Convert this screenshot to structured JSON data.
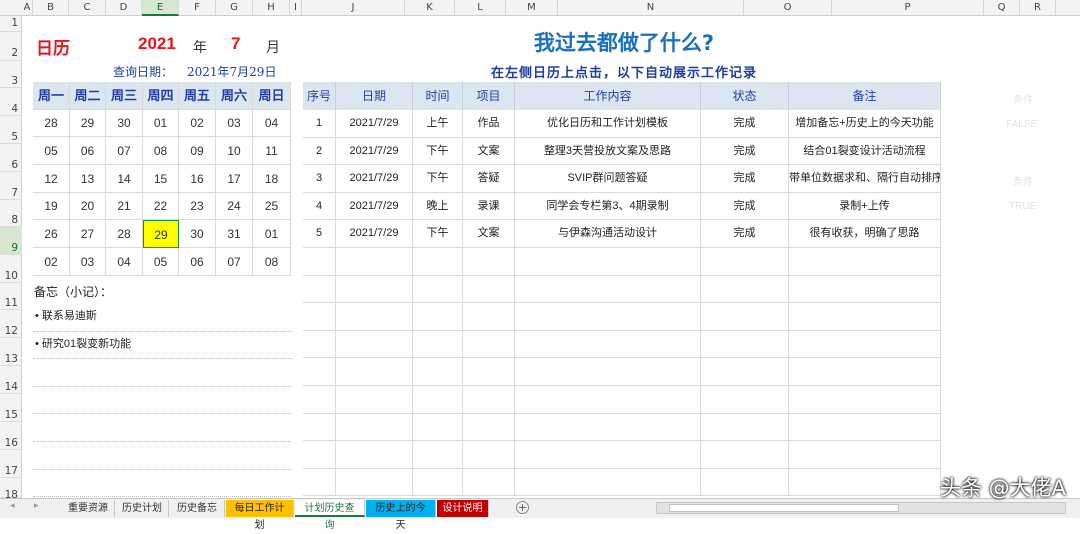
{
  "columns": [
    {
      "label": "A",
      "selected": false
    },
    {
      "label": "B",
      "selected": false
    },
    {
      "label": "C",
      "selected": false
    },
    {
      "label": "D",
      "selected": false
    },
    {
      "label": "E",
      "selected": true
    },
    {
      "label": "F",
      "selected": false
    },
    {
      "label": "G",
      "selected": false
    },
    {
      "label": "H",
      "selected": false
    },
    {
      "label": "I",
      "selected": false
    },
    {
      "label": "J",
      "selected": false
    },
    {
      "label": "K",
      "selected": false
    },
    {
      "label": "L",
      "selected": false
    },
    {
      "label": "M",
      "selected": false
    },
    {
      "label": "N",
      "selected": false
    },
    {
      "label": "O",
      "selected": false
    },
    {
      "label": "P",
      "selected": false
    },
    {
      "label": "Q",
      "selected": false
    },
    {
      "label": "R",
      "selected": false
    }
  ],
  "rows": [
    "1",
    "2",
    "3",
    "4",
    "5",
    "6",
    "7",
    "8",
    "9",
    "10",
    "11",
    "12",
    "13",
    "14",
    "15",
    "16",
    "17",
    "18"
  ],
  "selected_row": "9",
  "calendar": {
    "title": "日历",
    "year": "2021",
    "year_unit": "年",
    "month": "7",
    "month_unit": "月",
    "query_label": "查询日期：",
    "query_date": "2021年7月29日",
    "weekdays": [
      "周一",
      "周二",
      "周三",
      "周四",
      "周五",
      "周六",
      "周日"
    ],
    "weeks": [
      [
        "28",
        "29",
        "30",
        "01",
        "02",
        "03",
        "04"
      ],
      [
        "05",
        "06",
        "07",
        "08",
        "09",
        "10",
        "11"
      ],
      [
        "12",
        "13",
        "14",
        "15",
        "16",
        "17",
        "18"
      ],
      [
        "19",
        "20",
        "21",
        "22",
        "23",
        "24",
        "25"
      ],
      [
        "26",
        "27",
        "28",
        "29",
        "30",
        "31",
        "01"
      ],
      [
        "02",
        "03",
        "04",
        "05",
        "06",
        "07",
        "08"
      ]
    ],
    "selected_day": "29",
    "highlight_color": "#ffff00",
    "accent_red": "#e8141c"
  },
  "memo": {
    "title": "备忘（小记）：",
    "items": [
      "• 联系易迪斯",
      "• 研究01裂变新功能"
    ]
  },
  "main": {
    "title": "我过去都做了什么?",
    "subtitle": "在左侧日历上点击，以下自动展示工作记录",
    "title_color": "#1a6fc4",
    "headers": [
      "序号",
      "日期",
      "时间",
      "项目",
      "工作内容",
      "状态",
      "备注"
    ],
    "records": [
      [
        "1",
        "2021/7/29",
        "上午",
        "作品",
        "优化日历和工作计划模板",
        "完成",
        "增加备忘+历史上的今天功能"
      ],
      [
        "2",
        "2021/7/29",
        "下午",
        "文案",
        "整理3天营投放文案及思路",
        "完成",
        "结合01裂变设计活动流程"
      ],
      [
        "3",
        "2021/7/29",
        "下午",
        "答疑",
        "SVIP群问题答疑",
        "完成",
        "带单位数据求和、隔行自动排序"
      ],
      [
        "4",
        "2021/7/29",
        "晚上",
        "录课",
        "同学会专栏第3、4期录制",
        "完成",
        "录制+上传"
      ],
      [
        "5",
        "2021/7/29",
        "下午",
        "文案",
        "与伊森沟通活动设计",
        "完成",
        "很有收获，明确了思路"
      ]
    ]
  },
  "hidden_cells": {
    "cond1_label": "条件",
    "cond1_value": "FALSE",
    "cond2_label": "条件",
    "cond2_value": "TRUE"
  },
  "sheet_tabs": [
    {
      "label": "重要资源",
      "color": "#f0f0f0",
      "text": "#333333"
    },
    {
      "label": "历史计划",
      "color": "#f0f0f0",
      "text": "#333333"
    },
    {
      "label": "历史备忘",
      "color": "#f0f0f0",
      "text": "#333333"
    },
    {
      "label": "每日工作计划",
      "color": "#ffc000",
      "text": "#222222"
    },
    {
      "label": "计划历史查询",
      "color": "#ffffff",
      "text": "#217346"
    },
    {
      "label": "历史上的今天",
      "color": "#00b0f0",
      "text": "#222222"
    },
    {
      "label": "设计说明",
      "color": "#c00000",
      "text": "#ffffff"
    }
  ],
  "watermark": "头条 @大佬A"
}
